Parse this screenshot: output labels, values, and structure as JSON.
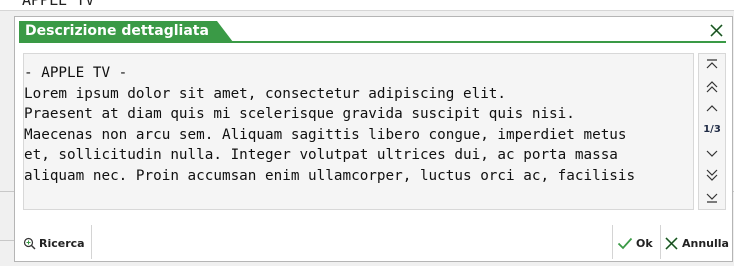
{
  "background": {
    "partial_text": "APPLE TV"
  },
  "dialog": {
    "title": "Descrizione dettagliata",
    "accent_color": "#3a9a46",
    "close_icon": "close-x-icon",
    "content_lines": [
      "- APPLE TV -",
      "Lorem ipsum dolor sit amet, consectetur adipiscing elit.",
      "Praesent at diam quis mi scelerisque gravida suscipit quis nisi.",
      "Maecenas non arcu sem. Aliquam sagittis libero congue, imperdiet metus",
      "et, sollicitudin nulla. Integer volutpat ultrices dui, ac porta massa",
      "aliquam nec. Proin accumsan enim ullamcorper, luctus orci ac, facilisis"
    ],
    "page_indicator": "1/3",
    "scroll_icons": [
      "scroll-top-icon",
      "page-up-icon",
      "line-up-icon",
      "line-down-icon",
      "page-down-icon",
      "scroll-bottom-icon"
    ]
  },
  "footer": {
    "search_label": "Ricerca",
    "ok_label": "Ok",
    "cancel_label": "Annulla"
  }
}
